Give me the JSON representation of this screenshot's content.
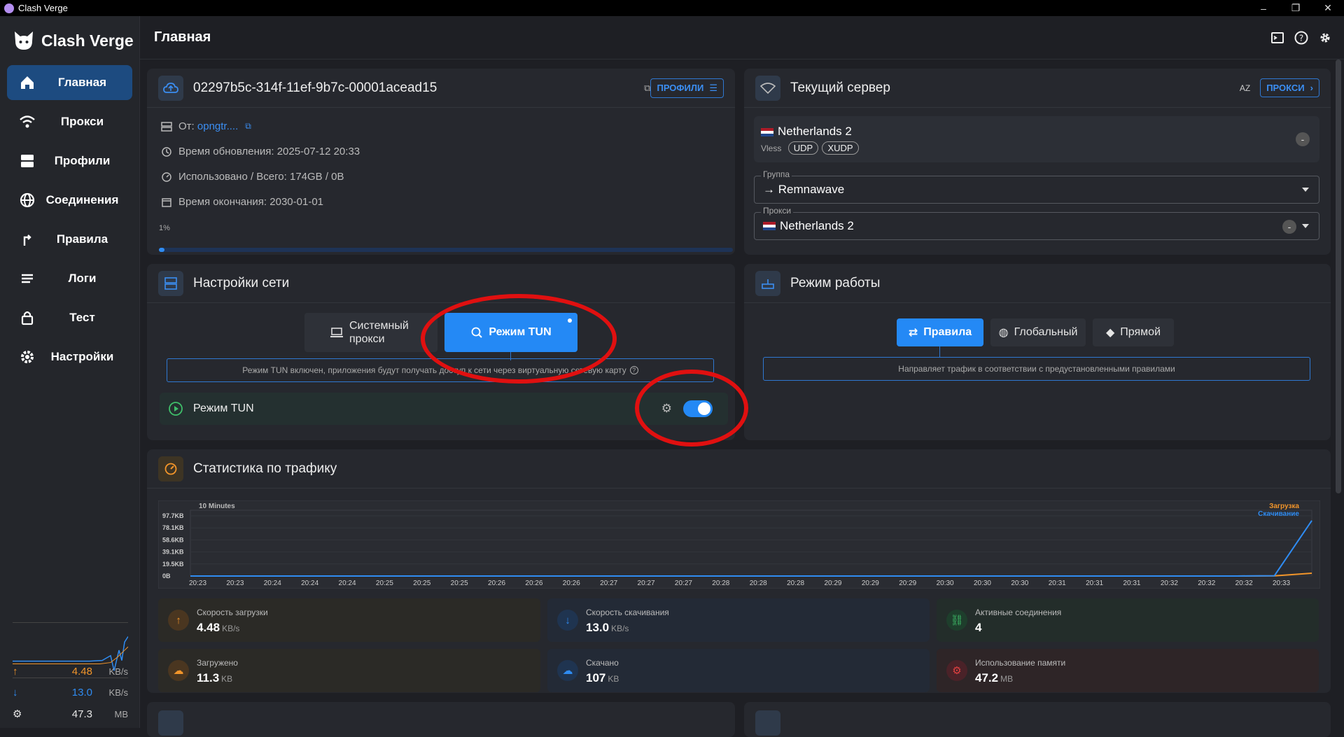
{
  "window": {
    "title": "Clash Verge",
    "min": "–",
    "restore": "❐",
    "close": "✕"
  },
  "brand": {
    "name": "Clash Verge"
  },
  "nav": [
    {
      "label": "Главная",
      "icon": "home-icon",
      "active": true
    },
    {
      "label": "Прокси",
      "icon": "wifi-icon"
    },
    {
      "label": "Профили",
      "icon": "server-icon"
    },
    {
      "label": "Соединения",
      "icon": "globe-icon"
    },
    {
      "label": "Правила",
      "icon": "fork-icon"
    },
    {
      "label": "Логи",
      "icon": "list-icon"
    },
    {
      "label": "Тест",
      "icon": "lock-icon"
    },
    {
      "label": "Настройки",
      "icon": "gear-icon"
    }
  ],
  "side_stats": {
    "up": {
      "value": "4.48",
      "unit": "KB/s",
      "color": "#f2952a"
    },
    "down": {
      "value": "13.0",
      "unit": "KB/s",
      "color": "#2f8cf2"
    },
    "mem": {
      "value": "47.3",
      "unit": "MB"
    }
  },
  "header": {
    "title": "Главная"
  },
  "profile": {
    "name": "02297b5c-314f-11ef-9b7c-00001acead15",
    "button": "ПРОФИЛИ",
    "from_label": "От:",
    "from_value": "opngtr....",
    "updated": "Время обновления: 2025-07-12 20:33",
    "usage": "Использовано / Всего: 174GB / 0B",
    "expire": "Время окончания: 2030-01-01",
    "percent_label": "1%",
    "percent": 1
  },
  "server": {
    "title": "Текущий сервер",
    "sort_label": "AZ",
    "button": "ПРОКСИ",
    "name": "Netherlands 2",
    "type": "Vless",
    "tags": [
      "UDP",
      "XUDP"
    ],
    "status": "-",
    "group_label": "Группа",
    "group_value": "→ Remnawave",
    "proxy_label": "Прокси",
    "proxy_value": "Netherlands 2"
  },
  "network": {
    "title": "Настройки сети",
    "system_proxy": "Системный прокси",
    "tun_mode": "Режим TUN",
    "desc": "Режим TUN включен, приложения будут получать доступ к сети через виртуальную сетевую карту",
    "help": "?",
    "tun_row_label": "Режим TUN",
    "tun_enabled": true
  },
  "mode": {
    "title": "Режим работы",
    "rules": "Правила",
    "global": "Глобальный",
    "direct": "Прямой",
    "desc": "Направляет трафик в соответствии с предустановленными правилами"
  },
  "traffic": {
    "title": "Статистика по трафику",
    "chart_data": {
      "type": "line",
      "title": "10 Minutes",
      "y_ticks": [
        "97.7KB",
        "78.1KB",
        "58.6KB",
        "39.1KB",
        "19.5KB",
        "0B"
      ],
      "x_ticks": [
        "20:23",
        "20:23",
        "20:24",
        "20:24",
        "20:24",
        "20:25",
        "20:25",
        "20:25",
        "20:26",
        "20:26",
        "20:26",
        "20:27",
        "20:27",
        "20:27",
        "20:28",
        "20:28",
        "20:28",
        "20:29",
        "20:29",
        "20:29",
        "20:30",
        "20:30",
        "20:30",
        "20:31",
        "20:31",
        "20:31",
        "20:32",
        "20:32",
        "20:32",
        "20:33"
      ],
      "ylim": [
        0,
        97.7
      ],
      "legend_position": "top-right",
      "series": [
        {
          "name": "Загрузка",
          "color": "#f2952a",
          "values": [
            0,
            0,
            0,
            0,
            0,
            0,
            0,
            0,
            0,
            0,
            0,
            0,
            0,
            0,
            0,
            0,
            0,
            0,
            0,
            0,
            0,
            0,
            0,
            0,
            0,
            0,
            0,
            0,
            0,
            0.3,
            4.5
          ]
        },
        {
          "name": "Скачивание",
          "color": "#2f8cf2",
          "values": [
            0,
            0,
            0,
            0,
            0,
            0,
            0,
            0,
            0,
            0,
            0,
            0,
            0,
            0,
            0,
            0,
            0,
            0,
            0,
            0,
            0,
            0,
            0,
            0,
            0,
            0,
            0,
            0,
            0,
            0.5,
            90
          ]
        }
      ]
    },
    "tiles": [
      {
        "label": "Скорость загрузки",
        "value": "4.48",
        "unit": "KB/s",
        "icon": "arrow-up-icon",
        "icolor": "#f2952a",
        "bg": "#2b2a26",
        "ibg": "#4a3620"
      },
      {
        "label": "Скорость скачивания",
        "value": "13.0",
        "unit": "KB/s",
        "icon": "arrow-down-icon",
        "icolor": "#2f8cf2",
        "bg": "#232a36",
        "ibg": "#1f3450"
      },
      {
        "label": "Активные соединения",
        "value": "4",
        "unit": "",
        "icon": "link-icon",
        "icolor": "#3fbf6a",
        "bg": "#232d2a",
        "ibg": "#1e3e2c"
      },
      {
        "label": "Загружено",
        "value": "11.3",
        "unit": "KB",
        "icon": "cloud-upload-icon",
        "icolor": "#f2952a",
        "bg": "#2b2a26",
        "ibg": "#4a3620"
      },
      {
        "label": "Скачано",
        "value": "107",
        "unit": "KB",
        "icon": "cloud-download-icon",
        "icolor": "#2f8cf2",
        "bg": "#232a36",
        "ibg": "#1f3450"
      },
      {
        "label": "Использование памяти",
        "value": "47.2",
        "unit": "MB",
        "icon": "memory-icon",
        "icolor": "#e04040",
        "bg": "#2e2527",
        "ibg": "#4a2228"
      }
    ]
  }
}
